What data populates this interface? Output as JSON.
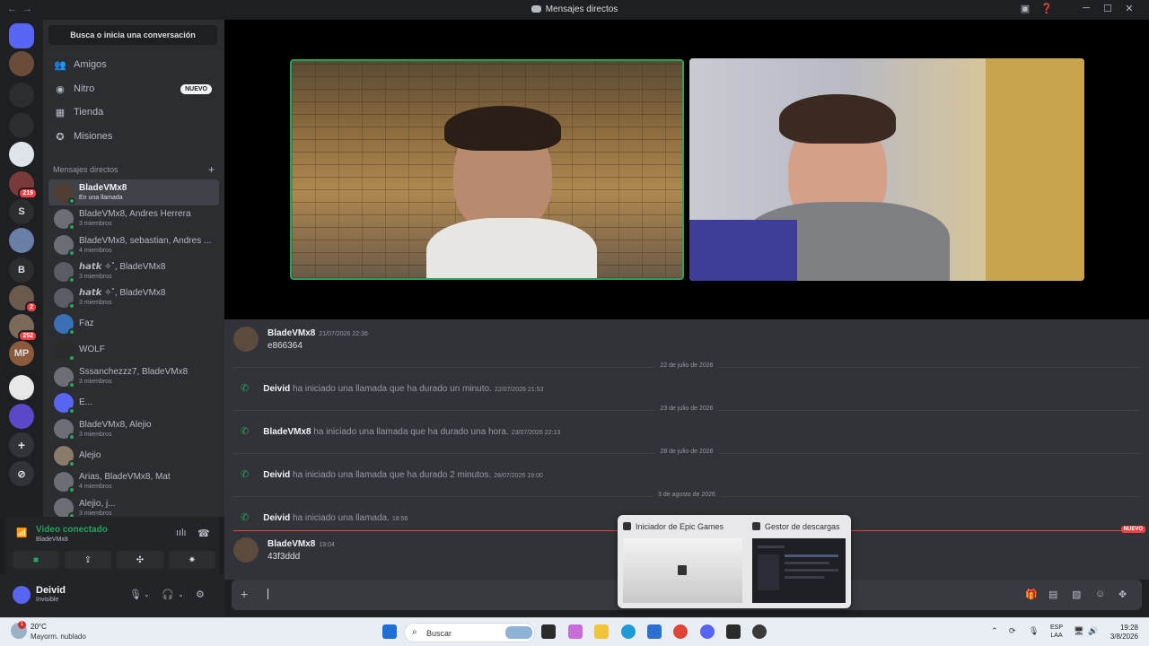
{
  "window": {
    "title": "Mensajes directos",
    "nav_back": "←",
    "nav_forward": "→"
  },
  "sidebar": {
    "search_label": "Busca o inicia una conversación",
    "nav": [
      {
        "label": "Amigos",
        "icon": "friends-icon"
      },
      {
        "label": "Nitro",
        "icon": "nitro-icon",
        "badge": "NUEVO"
      },
      {
        "label": "Tienda",
        "icon": "shop-icon"
      },
      {
        "label": "Misiones",
        "icon": "quests-icon"
      }
    ],
    "dm_header": "Mensajes directos",
    "dms": [
      {
        "name": "BladeVMx8",
        "sub": "En una llamada",
        "active": true
      },
      {
        "name": "BladeVMx8, Andres Herrera",
        "sub": "3 miembros"
      },
      {
        "name": "BladeVMx8, sebastian, Andres ...",
        "sub": "4 miembros"
      },
      {
        "name": "𝙝𝙖𝙩𝙠 ✧˚, BladeVMx8",
        "sub": "3 miembros"
      },
      {
        "name": "𝙝𝙖𝙩𝙠 ✧˚, BladeVMx8",
        "sub": "3 miembros"
      },
      {
        "name": "Faz",
        "sub": ""
      },
      {
        "name": "WOLF",
        "sub": ""
      },
      {
        "name": "Sssanchezzz7, BladeVMx8",
        "sub": "3 miembros"
      },
      {
        "name": "E...",
        "sub": ""
      },
      {
        "name": "BladeVMx8, Alejio",
        "sub": "3 miembros"
      },
      {
        "name": "Alejio",
        "sub": ""
      },
      {
        "name": "Arias, BladeVMx8, Mat",
        "sub": "4 miembros"
      },
      {
        "name": "Alejio, j...",
        "sub": "3 miembros"
      }
    ]
  },
  "servers": [
    {
      "label": "",
      "badge": ""
    },
    {
      "label": "",
      "badge": ""
    },
    {
      "label": "",
      "badge": ""
    },
    {
      "label": "",
      "badge": ""
    },
    {
      "label": "",
      "badge": ""
    },
    {
      "label": "",
      "badge": "219"
    },
    {
      "label": "S",
      "badge": ""
    },
    {
      "label": "",
      "badge": ""
    },
    {
      "label": "B",
      "badge": ""
    },
    {
      "label": "",
      "badge": "2"
    },
    {
      "label": "",
      "badge": "252"
    },
    {
      "label": "MP",
      "badge": ""
    },
    {
      "label": "",
      "badge": ""
    },
    {
      "label": "",
      "badge": ""
    }
  ],
  "voice": {
    "status": "Video conectado",
    "channel": "BladeVMx8"
  },
  "user": {
    "name": "Deivid",
    "status": "Invisible"
  },
  "messages": [
    {
      "author": "BladeVMx8",
      "time": "21/07/2026 22:36",
      "text": "e866364"
    },
    {
      "author": "BladeVMx8",
      "time": "19:04",
      "text": "43f3ddd"
    }
  ],
  "dates": [
    "22 de julio de 2026",
    "23 de julio de 2026",
    "28 de julio de 2026",
    "3 de agosto de 2026"
  ],
  "calls": [
    {
      "author": "Deivid",
      "text": "ha iniciado una llamada que ha durado un minuto.",
      "time": "22/07/2026 21:53"
    },
    {
      "author": "BladeVMx8",
      "text": "ha iniciado una llamada que ha durado una hora.",
      "time": "23/07/2026 22:13"
    },
    {
      "author": "Deivid",
      "text": "ha iniciado una llamada que ha durado 2 minutos.",
      "time": "28/07/2026 19:00"
    },
    {
      "author": "Deivid",
      "text": "ha iniciado una llamada.",
      "time": "18:56"
    }
  ],
  "new_marker": "NUEVO",
  "popup": {
    "tab1": "Iniciador de Epic Games",
    "tab2": "Gestor de descargas"
  },
  "taskbar": {
    "temperature": "20°C",
    "condition": "Mayorm. nublado",
    "weather_badge": "1",
    "search": "Buscar",
    "lang1": "ESP",
    "lang2": "LAA",
    "time": "19:28",
    "date": "3/8/2026"
  },
  "colors": {
    "accent": "#5865f2",
    "online": "#23a55a",
    "danger": "#f23f43"
  }
}
